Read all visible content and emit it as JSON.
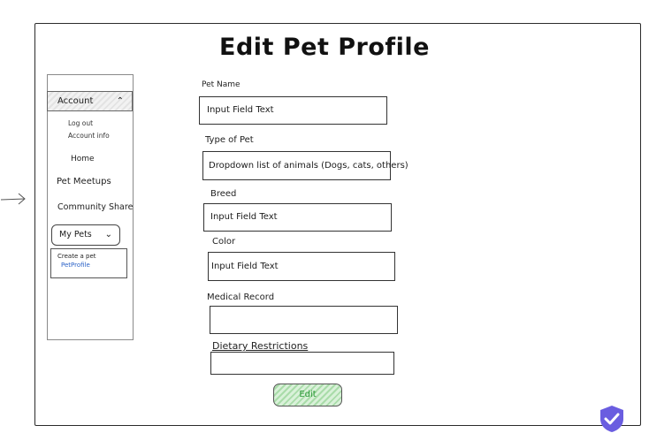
{
  "page": {
    "title": "Edit Pet Profile"
  },
  "sidebar": {
    "account_label": "Account",
    "account_submenu": [
      "Log out",
      "Account info"
    ],
    "items": [
      "Home",
      "Pet Meetups",
      "Community Share"
    ],
    "my_pets_label": "My Pets",
    "my_pets_menu": {
      "line1": "Create a pet",
      "line2": "PetProfile"
    }
  },
  "form": {
    "pet_name": {
      "label": "Pet Name",
      "value": "Input Field Text"
    },
    "type_of_pet": {
      "label": "Type of Pet",
      "value": "Dropdown list of animals (Dogs, cats, others)"
    },
    "breed": {
      "label": "Breed",
      "value": "Input Field Text"
    },
    "color": {
      "label": "Color",
      "value": "Input Field Text"
    },
    "medical_record": {
      "label": "Medical Record",
      "value": ""
    },
    "dietary_restrictions": {
      "label": "Dietary Restrictions",
      "value": ""
    }
  },
  "actions": {
    "edit_label": "Edit"
  },
  "icons": {
    "arrow": "arrow-right-icon",
    "chevron": "chevron-up-icon",
    "chevron_down": "chevron-down-icon",
    "badge": "shield-check-icon"
  },
  "colors": {
    "button_bg": "#a9dca9",
    "button_text": "#2e9a3a",
    "link": "#2a62c7",
    "badge": "#6a5de0"
  }
}
